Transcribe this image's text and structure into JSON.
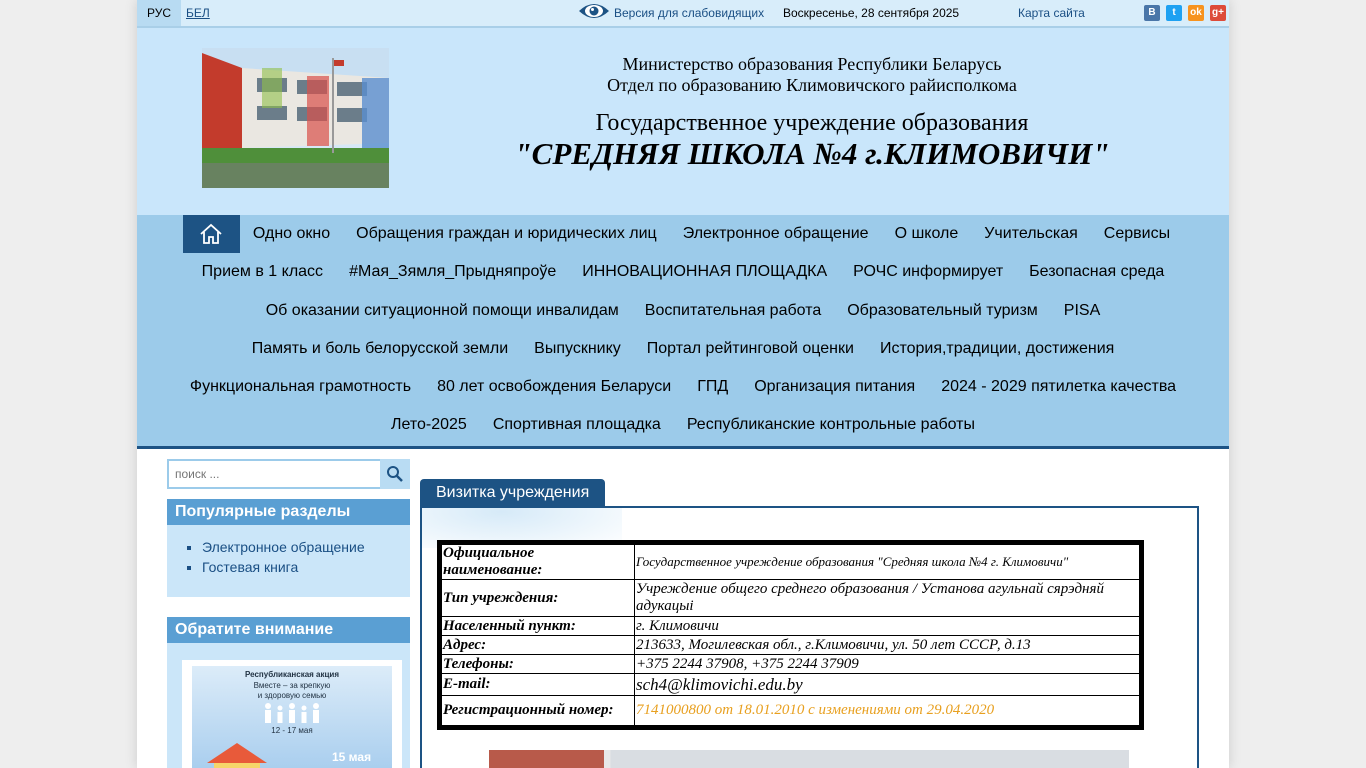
{
  "topbar": {
    "lang_ru": "РУС",
    "lang_by": "БЕЛ",
    "vision_link": "Версия для слабовидящих",
    "date": "Воскресенье, 28 сентября 2025",
    "sitemap": "Карта сайта",
    "social": [
      {
        "icon": "vk-icon",
        "glyph": "B",
        "color": "#4a76a8"
      },
      {
        "icon": "twitter-icon",
        "glyph": "t",
        "color": "#1da1f2"
      },
      {
        "icon": "odnoklassniki-icon",
        "glyph": "ok",
        "color": "#f7931e"
      },
      {
        "icon": "google-plus-icon",
        "glyph": "g+",
        "color": "#dd4b39"
      }
    ]
  },
  "header": {
    "ministry": "Министерство образования Республики Беларусь",
    "department": "Отдел по образованию Климовичского райисполкома",
    "institution": "Государственное учреждение образования",
    "school_name": "\"СРЕДНЯЯ ШКОЛА №4 г.КЛИМОВИЧИ\""
  },
  "nav": {
    "rows": [
      [
        "Одно окно",
        "Обращения граждан и юридических лиц",
        "Электронное обращение",
        "О школе",
        "Учительская",
        "Сервисы"
      ],
      [
        "Прием в 1 класс",
        "#Мая_Зямля_Прыдняпроўе",
        "ИННОВАЦИОННАЯ ПЛОЩАДКА",
        "РОЧС информирует",
        "Безопасная среда"
      ],
      [
        "Об оказании ситуационной помощи инвалидам",
        "Воспитательная работа",
        "Образовательный туризм",
        "PISA"
      ],
      [
        "Память и боль белорусской земли",
        "Выпускнику",
        "Портал рейтинговой оценки",
        "История,традиции, достижения"
      ],
      [
        "Функциональная грамотность",
        "80 лет освобождения Беларуси",
        "ГПД",
        "Организация питания",
        "2024 - 2029 пятилетка качества"
      ],
      [
        "Лето-2025",
        "Спортивная площадка",
        "Республиканские контрольные работы"
      ]
    ]
  },
  "sidebar": {
    "search_placeholder": "поиск ...",
    "popular_title": "Популярные разделы",
    "popular_items": [
      "Электронное обращение",
      "Гостевая книга"
    ],
    "attention_title": "Обратите внимание",
    "banner": {
      "line1": "Республиканская акция",
      "line2": "Вместе – за крепкую",
      "line3": "и здоровую семью",
      "dates": "12 - 17 мая",
      "day": "15 мая"
    }
  },
  "main": {
    "tab_label": "Визитка учреждения",
    "info_rows": [
      {
        "key": "Официальное наименование:",
        "value": "Государственное учреждение образования \"Средняя школа №4 г. Климовичи\""
      },
      {
        "key": "Тип учреждения:",
        "value": "Учреждение общего среднего образования / Установа агульнай сярэдняй адукацыі"
      },
      {
        "key": "Населенный пункт:",
        "value": "г. Климовичи"
      },
      {
        "key": "Адрес:",
        "value": "213633, Могилевская обл., г.Климовичи, ул. 50 лет СССР, д.13"
      },
      {
        "key": "Телефоны:",
        "value": "+375 2244 37908, +375 2244 37909"
      },
      {
        "key": "E-mail:",
        "value": "sch4@klimovichi.edu.by"
      },
      {
        "key": "Регистрационный номер:",
        "value": "7141000800 от 18.01.2010 с изменениями от 29.04.2020"
      }
    ],
    "reg_color": "#e8a020"
  }
}
